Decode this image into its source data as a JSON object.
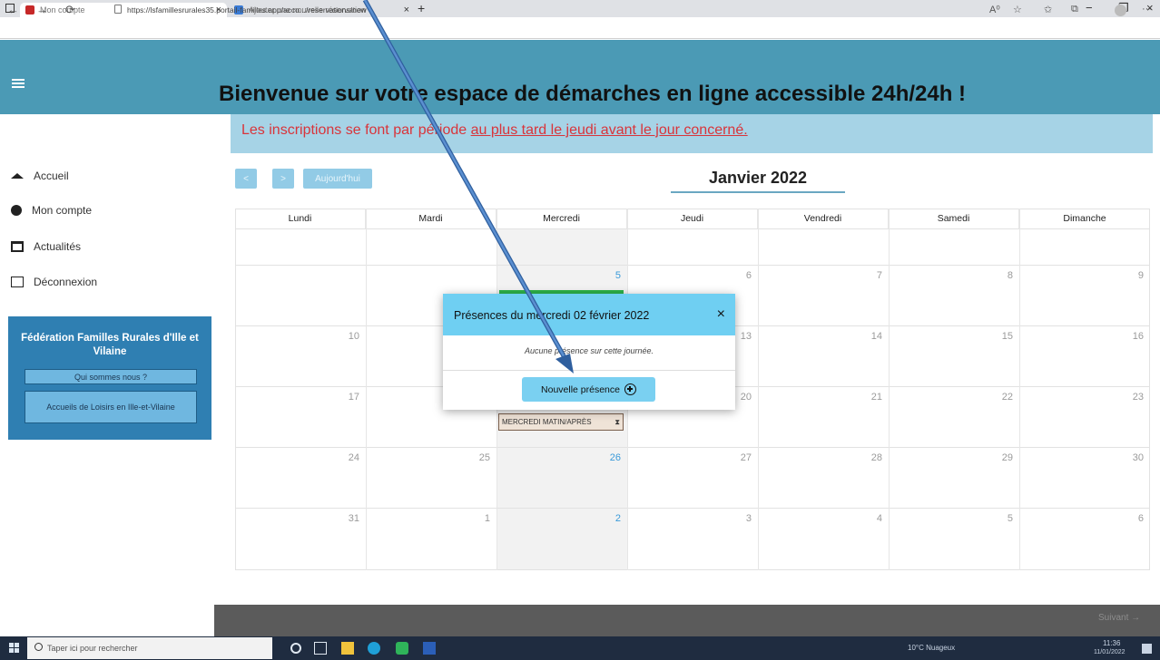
{
  "browser": {
    "tabs": [
      {
        "title": "Mon compte",
        "close": "×"
      },
      {
        "title": "Ajouter une nouvelle réservation",
        "close": "×"
      }
    ],
    "new_tab": "+",
    "window_controls": [
      "−",
      "❐",
      "×"
    ],
    "url": "https://lsfamillesrurales35.portail-familles.app/acco.../reservations/new",
    "nav": {
      "back": "←",
      "forward": "→",
      "refresh": "⟳"
    },
    "toolbar_icons": [
      "A⁰",
      "☆",
      "✩",
      "⧉",
      "···"
    ]
  },
  "header": {
    "menu_icon": "hamburger-icon",
    "title": "Bienvenue sur votre espace de démarches en ligne accessible 24h/24h !"
  },
  "sidebar": {
    "items": [
      {
        "label": "Accueil",
        "icon": "home-icon"
      },
      {
        "label": "Mon compte",
        "icon": "user-icon"
      },
      {
        "label": "Actualités",
        "icon": "news-icon"
      },
      {
        "label": "Déconnexion",
        "icon": "logout-icon"
      }
    ],
    "federation": {
      "title": "Fédération Familles Rurales d'Ille et Vilaine",
      "buttons": [
        "Qui sommes nous ?",
        "Accueils de Loisirs en Ille-et-Vilaine"
      ]
    }
  },
  "banner": {
    "text_before": "Les inscriptions se font par période ",
    "text_link": "au plus tard le jeudi avant le jour concerné."
  },
  "calendar": {
    "prev": "<",
    "next": ">",
    "today": "Aujourd'hui",
    "month": "Janvier 2022",
    "weekdays": [
      "Lundi",
      "Mardi",
      "Mercredi",
      "Jeudi",
      "Vendredi",
      "Samedi",
      "Dimanche"
    ],
    "weeks": [
      [
        "",
        "",
        "",
        "",
        "",
        "",
        ""
      ],
      [
        "",
        "",
        "5",
        "6",
        "7",
        "8",
        "9"
      ],
      [
        "10",
        "",
        "",
        "13",
        "14",
        "15",
        "16"
      ],
      [
        "17",
        "",
        "",
        "20",
        "21",
        "22",
        "23"
      ],
      [
        "24",
        "25",
        "26",
        "27",
        "28",
        "29",
        "30"
      ],
      [
        "31",
        "1",
        "2",
        "3",
        "4",
        "5",
        "6"
      ]
    ],
    "event_tag": "MERCREDI MATIN/APRÈS",
    "next_label": "Suivant →"
  },
  "modal": {
    "title": "Présences du mercredi 02 février 2022",
    "close": "×",
    "message": "Aucune présence sur cette journée.",
    "button": "Nouvelle présence"
  },
  "taskbar": {
    "search_placeholder": "Taper ici pour rechercher",
    "weather": "10°C Nuageux",
    "time": "11:36",
    "date": "11/01/2022"
  }
}
